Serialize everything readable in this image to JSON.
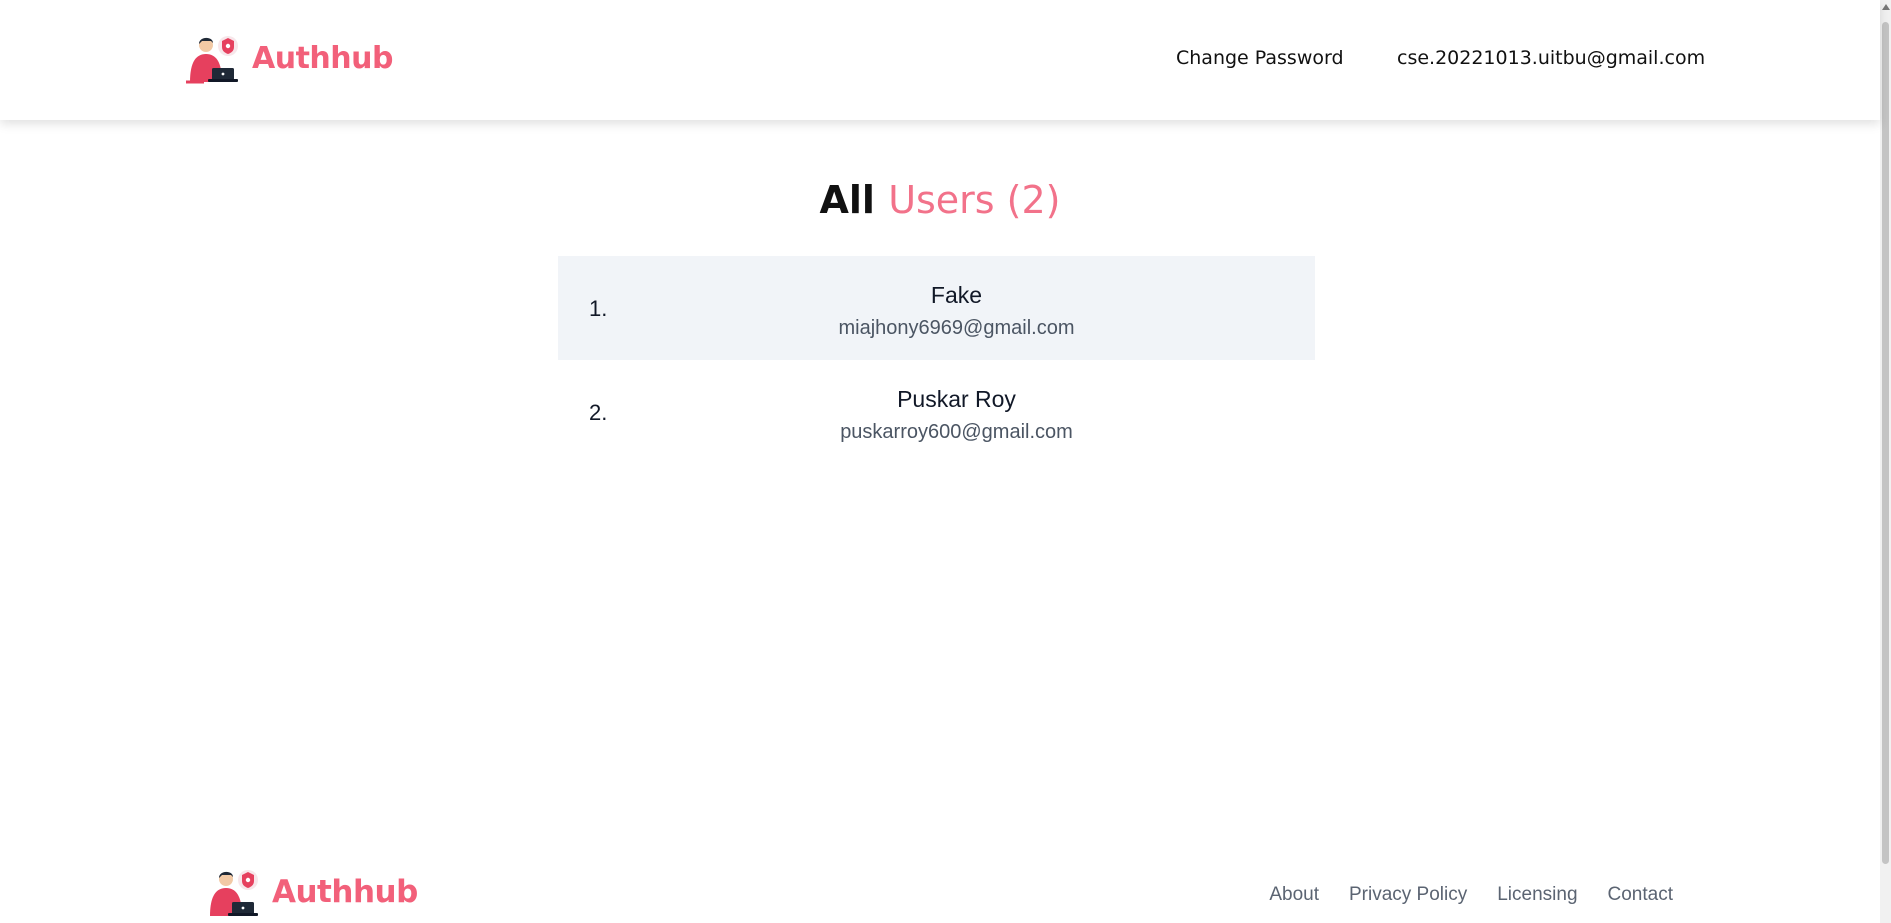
{
  "header": {
    "brand": "Authhub",
    "nav": {
      "change_password": "Change Password",
      "account_email": "cse.20221013.uitbu@gmail.com"
    }
  },
  "main": {
    "title_prefix": "All",
    "title_accent": "Users (2)",
    "users": [
      {
        "index": "1.",
        "name": "Fake",
        "email": "miajhony6969@gmail.com"
      },
      {
        "index": "2.",
        "name": "Puskar Roy",
        "email": "puskarroy600@gmail.com"
      }
    ]
  },
  "footer": {
    "brand": "Authhub",
    "links": [
      "About",
      "Privacy Policy",
      "Licensing",
      "Contact"
    ]
  },
  "colors": {
    "brand": "#f2607a",
    "accent": "#f2728a",
    "row_alt_bg": "#f1f4f8"
  },
  "icons": {
    "logo": "person-with-laptop-shield-icon"
  }
}
